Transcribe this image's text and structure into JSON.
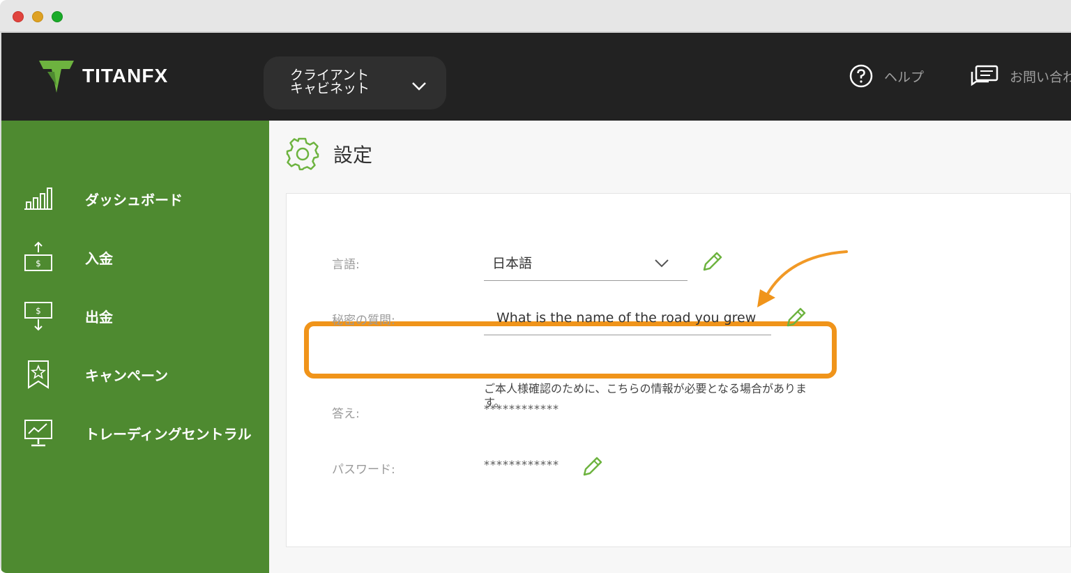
{
  "window": {
    "controls": [
      "close",
      "minimize",
      "maximize"
    ]
  },
  "header": {
    "logo_text": "TITANFX",
    "client_cabinet": {
      "label": "クライアント\nキャビネット",
      "icon": "chevron-down-icon"
    },
    "help": {
      "label": "ヘルプ",
      "icon": "question-circle-icon"
    },
    "contact": {
      "label": "お問い合わ",
      "icon": "chat-bubbles-icon"
    }
  },
  "sidebar": {
    "items": [
      {
        "label": "ダッシュボード",
        "icon": "bar-chart-icon"
      },
      {
        "label": "入金",
        "icon": "deposit-icon"
      },
      {
        "label": "出金",
        "icon": "withdraw-icon"
      },
      {
        "label": "キャンペーン",
        "icon": "campaign-star-icon"
      },
      {
        "label": "トレーディングセントラル",
        "icon": "monitor-chart-icon"
      }
    ]
  },
  "page": {
    "title": "設定",
    "icon": "gear-icon"
  },
  "settings": {
    "language": {
      "label": "言語:",
      "value": "日本語"
    },
    "secret_question": {
      "label": "秘密の質問:",
      "value": "What is the name of the road you grew ",
      "note": "ご本人様確認のために、こちらの情報が必要となる場合があります。"
    },
    "answer": {
      "label": "答え:",
      "value": "************"
    },
    "password": {
      "label": "パスワード:",
      "value": "************"
    }
  },
  "colors": {
    "header_bg": "#222222",
    "sidebar_bg": "#4e8a30",
    "accent_green": "#6db33f",
    "highlight_orange": "#f0941a"
  }
}
